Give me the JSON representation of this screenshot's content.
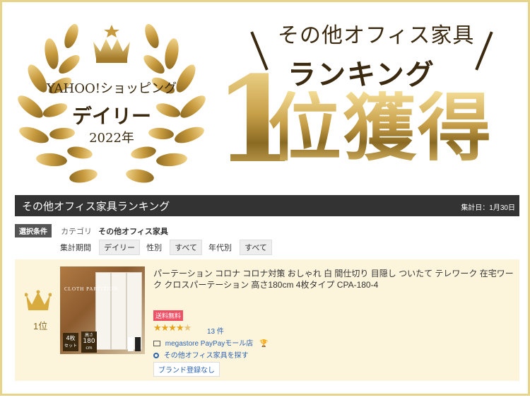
{
  "badge": {
    "line1": "YAHOO!ショッピング",
    "line2": "デイリー",
    "line3": "2022年"
  },
  "headline": {
    "category": "その他オフィス家具",
    "ranking": "ランキング",
    "number": "1",
    "result": "位獲得"
  },
  "ranking_bar": {
    "title": "その他オフィス家具ランキング",
    "date": "集計日：1月30日"
  },
  "filters": {
    "conditions_label": "選択条件",
    "category_label": "カテゴリ",
    "category_value": "その他オフィス家具",
    "period_label": "集計期間",
    "period_value": "デイリー",
    "gender_label": "性別",
    "gender_value": "すべて",
    "age_label": "年代別",
    "age_value": "すべて"
  },
  "item": {
    "rank": "1位",
    "title": "パーテーション コロナ コロナ対策 おしゃれ 白 間仕切り 目隠し ついたて テレワーク 在宅ワーク クロスパーテーション 高さ180cm 4枚タイプ CPA-180-4",
    "free_shipping": "送料無料",
    "rating": 4.5,
    "review_count": "13 件",
    "store": "megastore PayPayモール店",
    "find_link": "その他オフィス家具を探す",
    "brand": "ブランド登録なし",
    "thumb_caption": "CLOTH PARTITION",
    "thumb_badge_1": "4枚",
    "thumb_badge_1b": "セット",
    "thumb_badge_2": "高さ",
    "thumb_badge_2b": "180",
    "thumb_badge_2c": "cm"
  },
  "colors": {
    "gold": "#c8a04a",
    "dark_brown": "#3b2a10",
    "bar_bg": "#333333",
    "card_bg": "#fdf4dc",
    "link": "#2b63b3",
    "free_ship": "#f05065",
    "star": "#e8a21a"
  },
  "icons": [
    "laurel-wreath-icon",
    "crown-icon",
    "rank-crown-icon",
    "store-icon",
    "search-icon",
    "trophy-icon"
  ]
}
